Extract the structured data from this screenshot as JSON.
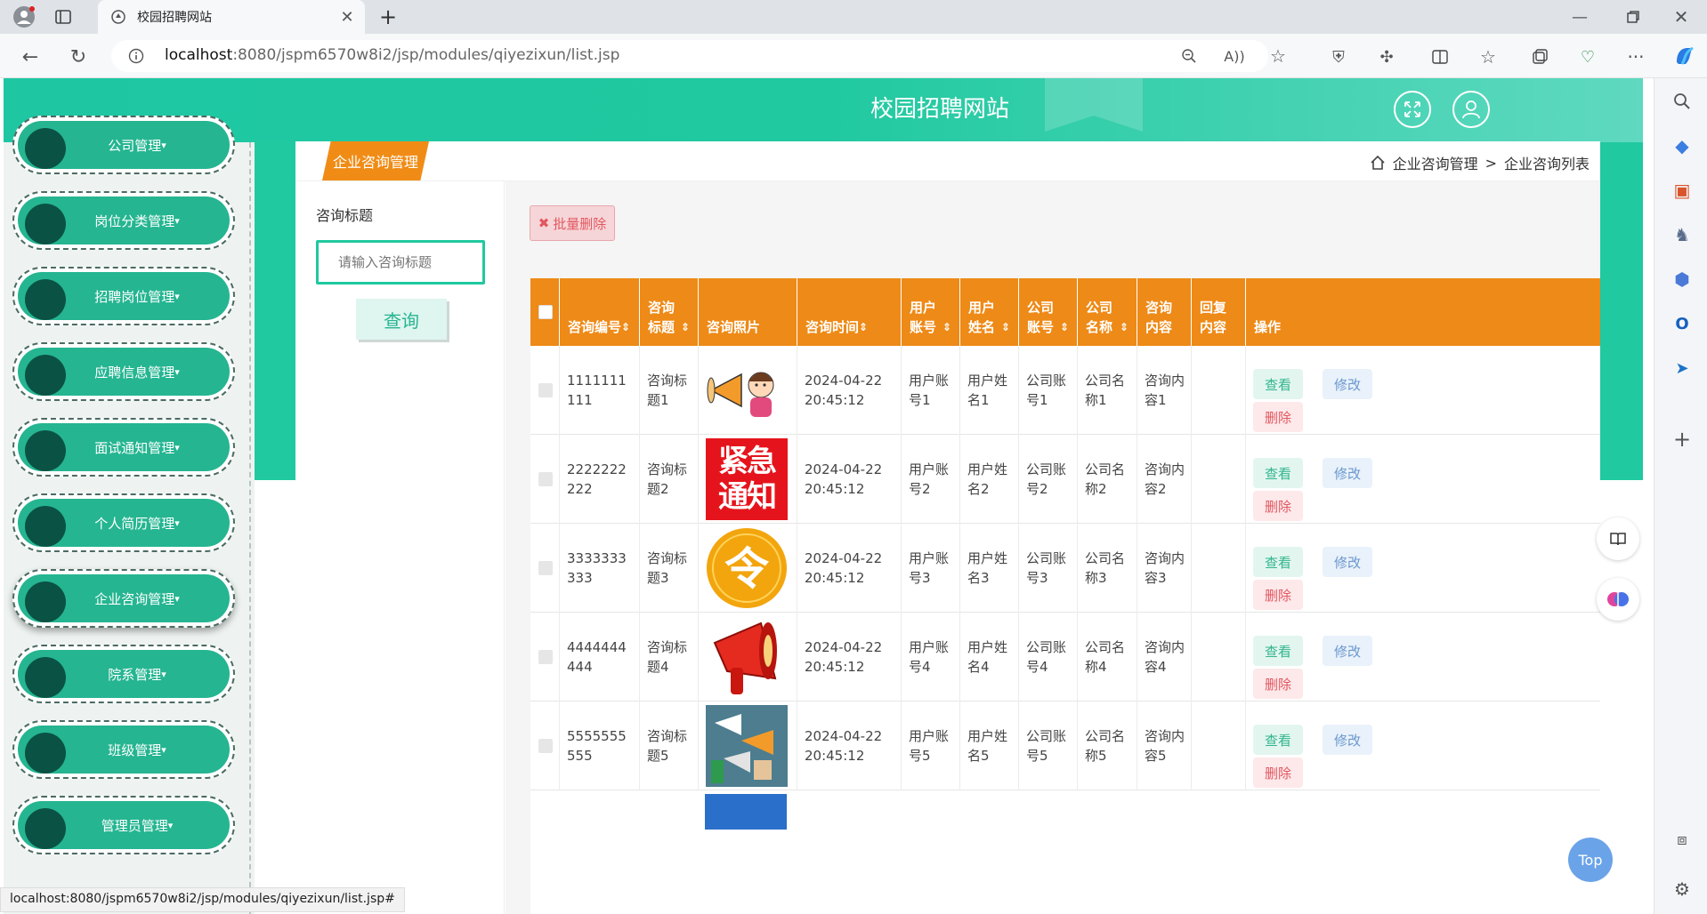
{
  "browser": {
    "tab_title": "校园招聘网站",
    "url_host": "localhost",
    "url_rest": ":8080/jspm6570w8i2/jsp/modules/qiyezixun/list.jsp",
    "status_url": "localhost:8080/jspm6570w8i2/jsp/modules/qiyezixun/list.jsp#"
  },
  "header": {
    "site_title": "校园招聘网站"
  },
  "sidebar": {
    "items": [
      {
        "label": "公司管理"
      },
      {
        "label": "岗位分类管理"
      },
      {
        "label": "招聘岗位管理"
      },
      {
        "label": "应聘信息管理"
      },
      {
        "label": "面试通知管理"
      },
      {
        "label": "个人简历管理"
      },
      {
        "label": "企业咨询管理"
      },
      {
        "label": "院系管理"
      },
      {
        "label": "班级管理"
      },
      {
        "label": "管理员管理"
      }
    ]
  },
  "content": {
    "section_tab": "企业咨询管理",
    "breadcrumb": {
      "first": "企业咨询管理",
      "sep": ">",
      "second": "企业咨询列表"
    },
    "filter_label": "咨询标题",
    "filter_placeholder": "请输入咨询标题",
    "search_button": "查询",
    "batch_delete": "批量删除",
    "back_to_top": "Top"
  },
  "table": {
    "headers": [
      "咨询编号",
      "咨询标题",
      "咨询照片",
      "咨询时间",
      "用户账号",
      "用户姓名",
      "公司账号",
      "公司名称",
      "咨询内容",
      "回复内容",
      "操作"
    ],
    "rows": [
      {
        "id": "1111111111",
        "title": "咨询标题1",
        "photo": "megaphone-girl",
        "date": "2024-04-22",
        "time": "20:45:12",
        "user_acc": "用户账号1",
        "user_name": "用户姓名1",
        "co_acc": "公司账号1",
        "co_name": "公司名称1",
        "content": "咨询内容1",
        "reply": ""
      },
      {
        "id": "2222222222",
        "title": "咨询标题2",
        "photo": "urgent-notice",
        "photo_text": "紧急通知",
        "date": "2024-04-22",
        "time": "20:45:12",
        "user_acc": "用户账号2",
        "user_name": "用户姓名2",
        "co_acc": "公司账号2",
        "co_name": "公司名称2",
        "content": "咨询内容2",
        "reply": ""
      },
      {
        "id": "3333333333",
        "title": "咨询标题3",
        "photo": "order-badge",
        "photo_text": "令",
        "date": "2024-04-22",
        "time": "20:45:12",
        "user_acc": "用户账号3",
        "user_name": "用户姓名3",
        "co_acc": "公司账号3",
        "co_name": "公司名称3",
        "content": "咨询内容3",
        "reply": ""
      },
      {
        "id": "4444444444",
        "title": "咨询标题4",
        "photo": "red-megaphone",
        "date": "2024-04-22",
        "time": "20:45:12",
        "user_acc": "用户账号4",
        "user_name": "用户姓名4",
        "co_acc": "公司账号4",
        "co_name": "公司名称4",
        "content": "咨询内容4",
        "reply": ""
      },
      {
        "id": "5555555555",
        "title": "咨询标题5",
        "photo": "hands-megaphones",
        "date": "2024-04-22",
        "time": "20:45:12",
        "user_acc": "用户账号5",
        "user_name": "用户姓名5",
        "co_acc": "公司账号5",
        "co_name": "公司名称5",
        "content": "咨询内容5",
        "reply": ""
      }
    ],
    "actions": {
      "view": "查看",
      "edit": "修改",
      "delete": "删除"
    }
  },
  "colors": {
    "primary": "#20c9a0",
    "table_header": "#ee8a17",
    "tab": "#f08c16",
    "nav_item": "#25b591"
  }
}
